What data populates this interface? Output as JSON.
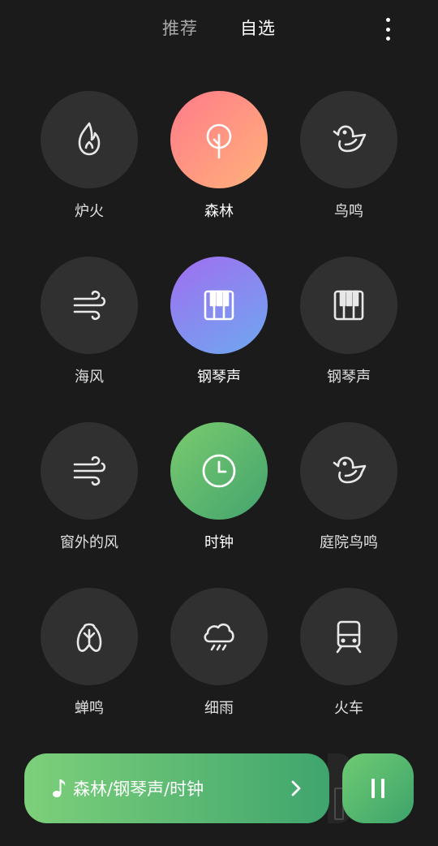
{
  "tabs": [
    {
      "label": "推荐",
      "selected": false
    },
    {
      "label": "自选",
      "selected": true
    }
  ],
  "menu_icon": "more-vertical-icon",
  "sounds": [
    {
      "label": "炉火",
      "icon": "flame-icon",
      "active": false
    },
    {
      "label": "森林",
      "icon": "tree-icon",
      "active": true,
      "gradient": [
        "#ff7a8a",
        "#ffb27a"
      ]
    },
    {
      "label": "鸟鸣",
      "icon": "bird-icon",
      "active": false
    },
    {
      "label": "海风",
      "icon": "wind-icon",
      "active": false
    },
    {
      "label": "钢琴声",
      "icon": "piano-icon",
      "active": true,
      "gradient": [
        "#a06ef0",
        "#6ea8f0"
      ]
    },
    {
      "label": "钢琴声",
      "icon": "piano-icon",
      "active": false
    },
    {
      "label": "窗外的风",
      "icon": "wind-icon",
      "active": false
    },
    {
      "label": "时钟",
      "icon": "clock-icon",
      "active": true,
      "gradient": [
        "#7acb6e",
        "#43a46e"
      ]
    },
    {
      "label": "庭院鸟鸣",
      "icon": "bird-icon",
      "active": false
    },
    {
      "label": "蝉鸣",
      "icon": "cicada-icon",
      "active": false
    },
    {
      "label": "细雨",
      "icon": "rain-cloud-icon",
      "active": false
    },
    {
      "label": "火车",
      "icon": "train-icon",
      "active": false
    }
  ],
  "player": {
    "now_playing": "森林/钢琴声/时钟",
    "icon": "music-note-icon",
    "chevron_icon": "chevron-right-icon",
    "pause_icon": "pause-icon",
    "colors": {
      "start": "#7dd07a",
      "end": "#3fa56d"
    }
  },
  "colors": {
    "background": "#1b1b1b",
    "circle": "#303030"
  }
}
